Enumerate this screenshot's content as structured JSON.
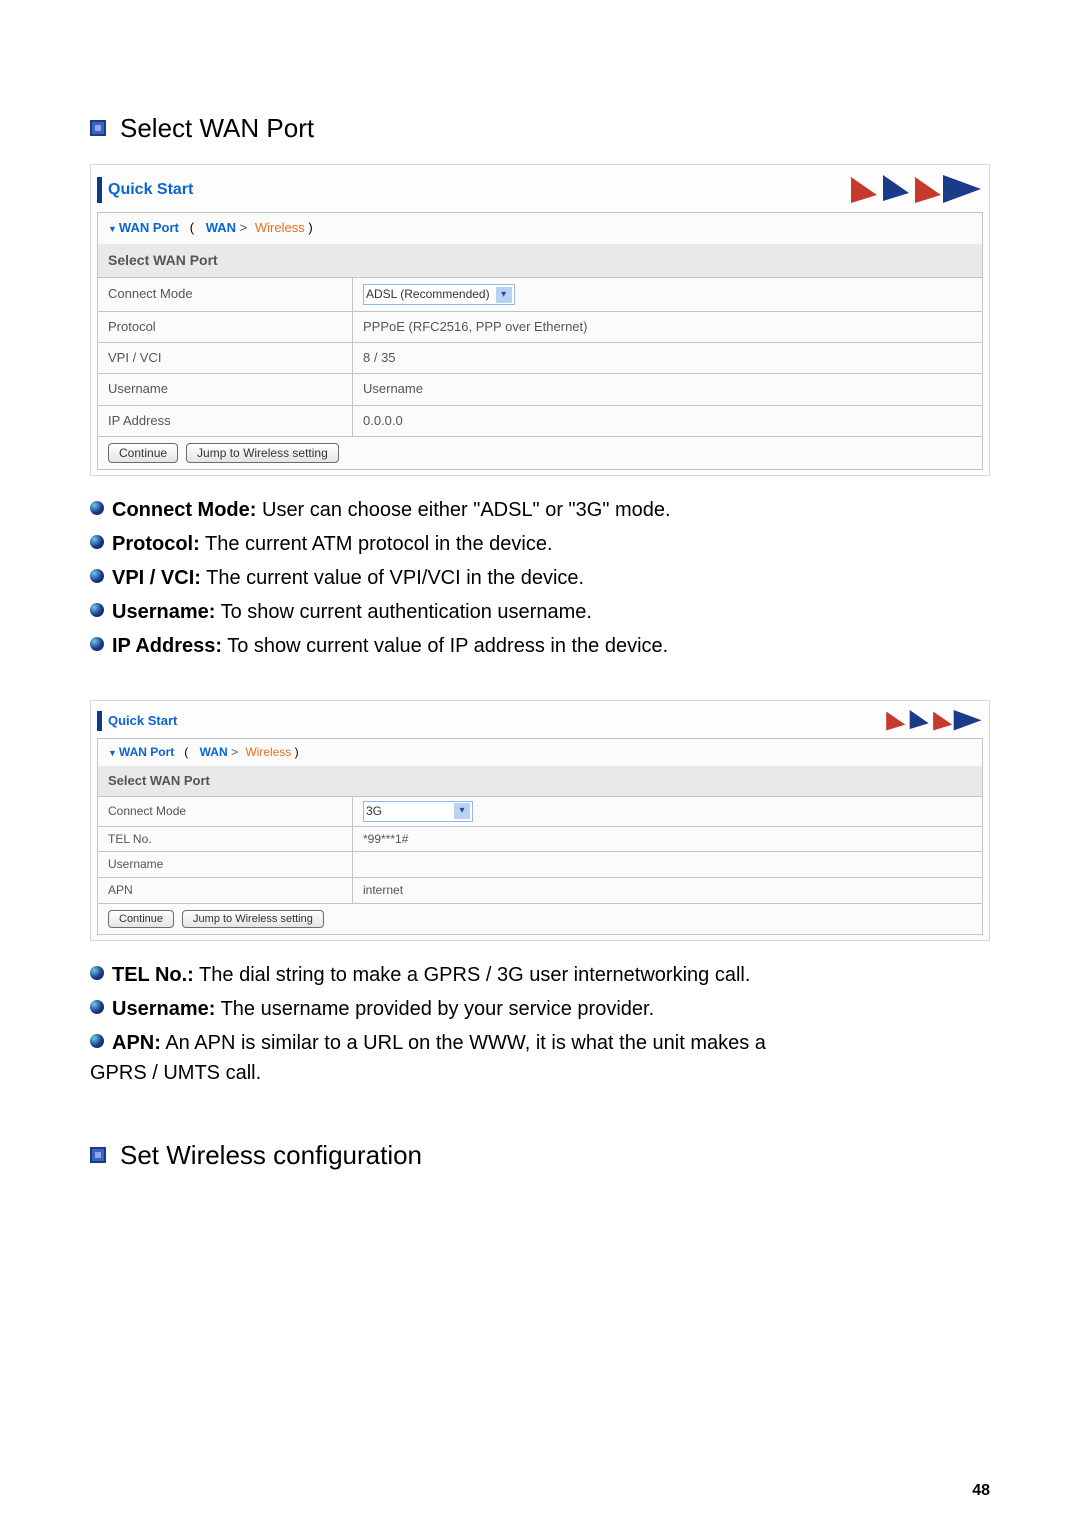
{
  "page_number": "48",
  "heading1": "Select WAN Port",
  "heading2": "Set Wireless configuration",
  "panel1": {
    "title": "Quick Start",
    "crumb1": "WAN Port",
    "crumb2": "WAN",
    "crumb3": "Wireless",
    "subhead": "Select WAN Port",
    "rows": {
      "r0_label": "Connect Mode",
      "r0_value": "ADSL (Recommended)",
      "r1_label": "Protocol",
      "r1_value": "PPPoE (RFC2516, PPP over Ethernet)",
      "r2_label": "VPI / VCI",
      "r2_value": "8 / 35",
      "r3_label": "Username",
      "r3_value": "Username",
      "r4_label": "IP Address",
      "r4_value": "0.0.0.0"
    },
    "btn_continue": "Continue",
    "btn_jump": "Jump to Wireless setting"
  },
  "desc1": {
    "i0_bold": "Connect Mode:",
    "i0_text": " User can choose either \"ADSL\" or \"3G\" mode.",
    "i1_bold": "Protocol:",
    "i1_text": " The current ATM protocol in the device.",
    "i2_bold": "VPI / VCI:",
    "i2_text": " The current value of VPI/VCI in the device.",
    "i3_bold": "Username:",
    "i3_text": " To show current authentication username.",
    "i4_bold": "IP Address:",
    "i4_text": " To show current value of IP address in the device."
  },
  "panel2": {
    "title": "Quick Start",
    "crumb1": "WAN Port",
    "crumb2": "WAN",
    "crumb3": "Wireless",
    "subhead": "Select WAN Port",
    "rows": {
      "r0_label": "Connect Mode",
      "r0_value": "3G",
      "r1_label": "TEL No.",
      "r1_value": "*99***1#",
      "r2_label": "Username",
      "r2_value": "",
      "r3_label": "APN",
      "r3_value": "internet"
    },
    "btn_continue": "Continue",
    "btn_jump": "Jump to Wireless setting"
  },
  "desc2": {
    "i0_bold": "TEL No.:",
    "i0_text": " The dial string to make a GPRS / 3G user internetworking call.",
    "i1_bold": "Username:",
    "i1_text": " The username provided by your service provider.",
    "i2_bold": "APN:",
    "i2_text": " An APN is similar to a URL on the WWW, it is what the unit makes a",
    "i2_cont": "GPRS / UMTS call."
  }
}
